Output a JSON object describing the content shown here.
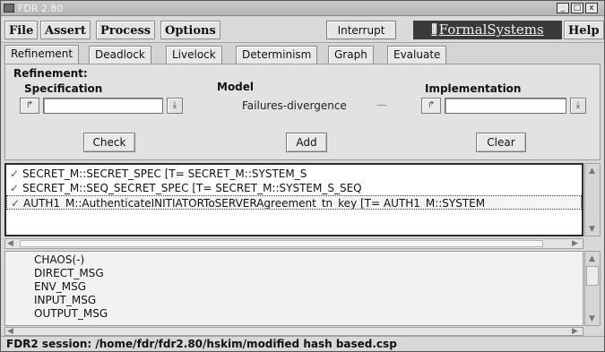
{
  "window": {
    "title": "FDR 2.80",
    "minimize": "_",
    "maximize": "□",
    "close": "x"
  },
  "menu": {
    "file": "File",
    "assert": "Assert",
    "process": "Process",
    "options": "Options",
    "interrupt": "Interrupt",
    "logo": "FormalSystems",
    "help": "Help"
  },
  "tabs": [
    "Refinement",
    "Deadlock",
    "Livelock",
    "Determinism",
    "Graph",
    "Evaluate"
  ],
  "refinement": {
    "heading": "Refinement:",
    "specification_label": "Specification",
    "model_label": "Model",
    "implementation_label": "Implementation",
    "specification_value": "",
    "implementation_value": "",
    "model_value": "Failures-divergence",
    "check": "Check",
    "add": "Add",
    "clear": "Clear"
  },
  "assertions": [
    "SECRET_M::SECRET_SPEC [T= SECRET_M::SYSTEM_S",
    "SECRET_M::SEQ_SECRET_SPEC [T= SECRET_M::SYSTEM_S_SEQ",
    "AUTH1_M::AuthenticateINITIATORToSERVERAgreement_tn_key [T= AUTH1_M::SYSTEM"
  ],
  "processes": [
    "CHAOS(-)",
    "DIRECT_MSG",
    "ENV_MSG",
    "INPUT_MSG",
    "OUTPUT_MSG"
  ],
  "status": "FDR2 session: /home/fdr/fdr2.80/hskim/modified hash based.csp"
}
